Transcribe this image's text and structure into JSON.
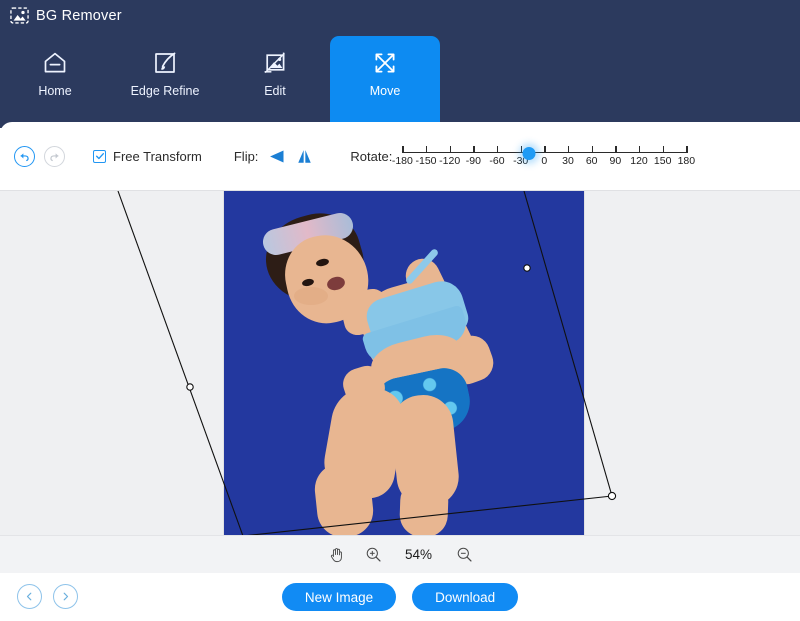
{
  "app": {
    "title": "BG Remover",
    "logo_icon": "image-dashed-icon"
  },
  "nav": {
    "tabs": [
      {
        "label": "Home",
        "icon": "home-icon",
        "active": false
      },
      {
        "label": "Edge Refine",
        "icon": "brush-square-icon",
        "active": false
      },
      {
        "label": "Edit",
        "icon": "picture-edit-icon",
        "active": false
      },
      {
        "label": "Move",
        "icon": "move-arrows-icon",
        "active": true
      }
    ]
  },
  "toolbar": {
    "undo_icon": "undo-arrow-icon",
    "redo_icon": "redo-arrow-icon",
    "free_transform_label": "Free Transform",
    "free_transform_checked": true,
    "flip_label": "Flip:",
    "flip_horizontal_icon": "flip-horizontal-icon",
    "flip_vertical_icon": "flip-vertical-icon",
    "rotate_label": "Rotate:",
    "rotate_value": -20,
    "rotate_min": -180,
    "rotate_max": 180,
    "rotate_ticks": [
      "-180",
      "-150",
      "-120",
      "-90",
      "-60",
      "-30",
      "0",
      "30",
      "60",
      "90",
      "120",
      "150",
      "180"
    ]
  },
  "canvas": {
    "image_background_color": "#23389f",
    "workspace_background_color": "#eff0f2",
    "transform_box_visible": true,
    "handles": 3
  },
  "zoombar": {
    "hand_icon": "hand-tool-icon",
    "zoom_in_icon": "zoom-in-icon",
    "zoom_out_icon": "zoom-out-icon",
    "zoom_level": "54%"
  },
  "footer": {
    "prev_icon": "chevron-left-circle-icon",
    "next_icon": "chevron-right-circle-icon",
    "new_image_label": "New Image",
    "download_label": "Download",
    "accent_color": "#118bf4"
  }
}
